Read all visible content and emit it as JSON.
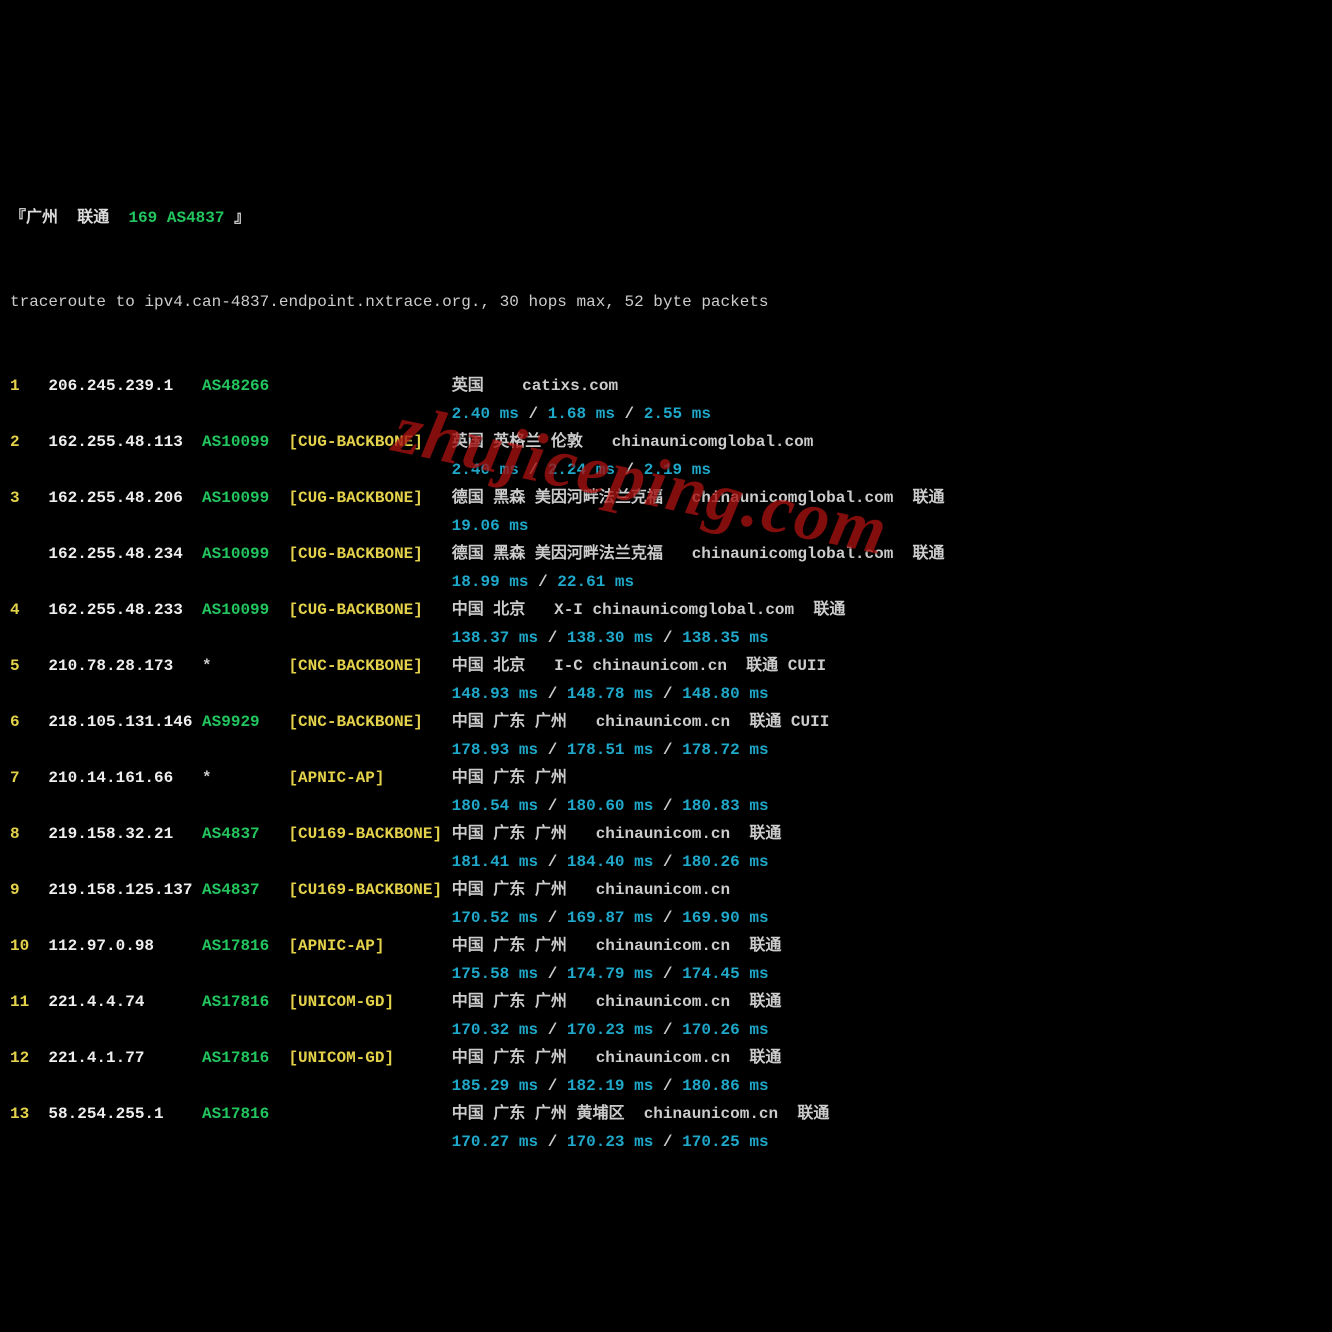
{
  "header": {
    "bracket_open": "『",
    "city": "广州",
    "carrier": "联通",
    "asn_label": "169 AS4837",
    "bracket_close": " 』"
  },
  "traceroute_line": "traceroute to ipv4.can-4837.endpoint.nxtrace.org., 30 hops max, 52 byte packets",
  "watermark": "zhujiceping.com",
  "hops": [
    {
      "num": "1",
      "ip": "206.245.239.1",
      "asn": "AS48266",
      "asn_star": false,
      "tag": "",
      "loc": "英国    catixs.com",
      "times": [
        "2.40 ms",
        "1.68 ms",
        "2.55 ms"
      ]
    },
    {
      "num": "2",
      "ip": "162.255.48.113",
      "asn": "AS10099",
      "asn_star": false,
      "tag": "[CUG-BACKBONE]",
      "loc": "英国 英格兰 伦敦   chinaunicomglobal.com",
      "times": [
        "2.40 ms",
        "2.24 ms",
        "2.19 ms"
      ]
    },
    {
      "num": "3",
      "ip": "162.255.48.206",
      "asn": "AS10099",
      "asn_star": false,
      "tag": "[CUG-BACKBONE]",
      "loc": "德国 黑森 美因河畔法兰克福   chinaunicomglobal.com  联通",
      "times": [
        "19.06 ms"
      ]
    },
    {
      "num": "",
      "ip": "162.255.48.234",
      "asn": "AS10099",
      "asn_star": false,
      "tag": "[CUG-BACKBONE]",
      "loc": "德国 黑森 美因河畔法兰克福   chinaunicomglobal.com  联通",
      "times": [
        "18.99 ms",
        "22.61 ms"
      ]
    },
    {
      "num": "4",
      "ip": "162.255.48.233",
      "asn": "AS10099",
      "asn_star": false,
      "tag": "[CUG-BACKBONE]",
      "loc": "中国 北京   X-I chinaunicomglobal.com  联通",
      "times": [
        "138.37 ms",
        "138.30 ms",
        "138.35 ms"
      ]
    },
    {
      "num": "5",
      "ip": "210.78.28.173",
      "asn": "*",
      "asn_star": true,
      "tag": "[CNC-BACKBONE]",
      "loc": "中国 北京   I-C chinaunicom.cn  联通 CUII",
      "times": [
        "148.93 ms",
        "148.78 ms",
        "148.80 ms"
      ]
    },
    {
      "num": "6",
      "ip": "218.105.131.146",
      "asn": "AS9929",
      "asn_star": false,
      "tag": "[CNC-BACKBONE]",
      "loc": "中国 广东 广州   chinaunicom.cn  联通 CUII",
      "times": [
        "178.93 ms",
        "178.51 ms",
        "178.72 ms"
      ]
    },
    {
      "num": "7",
      "ip": "210.14.161.66",
      "asn": "*",
      "asn_star": true,
      "tag": "[APNIC-AP]",
      "loc": "中国 广东 广州",
      "times": [
        "180.54 ms",
        "180.60 ms",
        "180.83 ms"
      ]
    },
    {
      "num": "8",
      "ip": "219.158.32.21",
      "asn": "AS4837",
      "asn_star": false,
      "tag": "[CU169-BACKBONE]",
      "loc": "中国 广东 广州   chinaunicom.cn  联通",
      "times": [
        "181.41 ms",
        "184.40 ms",
        "180.26 ms"
      ]
    },
    {
      "num": "9",
      "ip": "219.158.125.137",
      "asn": "AS4837",
      "asn_star": false,
      "tag": "[CU169-BACKBONE]",
      "loc": "中国 广东 广州   chinaunicom.cn",
      "times": [
        "170.52 ms",
        "169.87 ms",
        "169.90 ms"
      ]
    },
    {
      "num": "10",
      "ip": "112.97.0.98",
      "asn": "AS17816",
      "asn_star": false,
      "tag": "[APNIC-AP]",
      "loc": "中国 广东 广州   chinaunicom.cn  联通",
      "times": [
        "175.58 ms",
        "174.79 ms",
        "174.45 ms"
      ]
    },
    {
      "num": "11",
      "ip": "221.4.4.74",
      "asn": "AS17816",
      "asn_star": false,
      "tag": "[UNICOM-GD]",
      "loc": "中国 广东 广州   chinaunicom.cn  联通",
      "times": [
        "170.32 ms",
        "170.23 ms",
        "170.26 ms"
      ]
    },
    {
      "num": "12",
      "ip": "221.4.1.77",
      "asn": "AS17816",
      "asn_star": false,
      "tag": "[UNICOM-GD]",
      "loc": "中国 广东 广州   chinaunicom.cn  联通",
      "times": [
        "185.29 ms",
        "182.19 ms",
        "180.86 ms"
      ]
    },
    {
      "num": "13",
      "ip": "58.254.255.1",
      "asn": "AS17816",
      "asn_star": false,
      "tag": "",
      "loc": "中国 广东 广州 黄埔区  chinaunicom.cn  联通",
      "times": [
        "170.27 ms",
        "170.23 ms",
        "170.25 ms"
      ]
    }
  ]
}
